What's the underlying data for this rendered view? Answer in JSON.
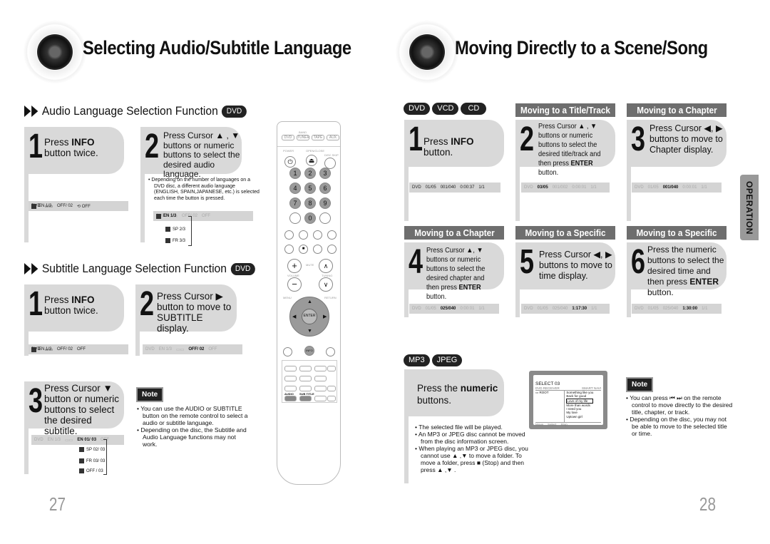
{
  "left_page": {
    "title": "Selecting Audio/Subtitle Language",
    "page_number": "27",
    "audio_section": {
      "heading": "Audio Language Selection Function",
      "badge": "DVD",
      "step1": {
        "num": "1",
        "text_a": "Press ",
        "bold": "INFO",
        "text_b": " button twice."
      },
      "step2": {
        "num": "2",
        "text": "Press Cursor ▲ , ▼ buttons or numeric buttons to select the desired audio language."
      },
      "step2_note": "Depending on the number of languages on a DVD disc, a different audio language (ENGLISH, SPAIN,JAPANESE, etc.) is selected each time the button is pressed.",
      "osd1": [
        "DVD",
        "EN 1/3",
        "OFF/ 02",
        "OFF"
      ],
      "osd2": [
        "DVD",
        "EN 1/3",
        "OFF/ 02",
        "OFF"
      ],
      "options": [
        "SP 2/3",
        "FR 3/3"
      ]
    },
    "subtitle_section": {
      "heading": "Subtitle Language Selection Function",
      "badge": "DVD",
      "step1": {
        "num": "1",
        "text_a": "Press ",
        "bold": "INFO",
        "text_b": " button twice."
      },
      "step2": {
        "num": "2",
        "text": "Press Cursor ▶ button to move to SUBTITLE display."
      },
      "step3": {
        "num": "3",
        "text": "Press Cursor ▼ button or numeric buttons to select the desired subtitle."
      },
      "osd1": [
        "DVD",
        "EN 1/3",
        "OFF/ 02",
        "OFF"
      ],
      "osd2": [
        "DVD",
        "EN 1/3",
        "OFF/ 02",
        "OFF"
      ],
      "osd3": [
        "DVD",
        "EN 1/3",
        "EN 01/ 03",
        "OFF"
      ],
      "options": [
        "SP 02/ 03",
        "FR 03/ 03",
        "OFF / 03"
      ]
    },
    "note": {
      "label": "Note",
      "items": [
        "You can use the AUDIO or SUBTITLE button on the remote control to select a audio or subtitle language.",
        "Depending on the disc, the Subtitle and Audio Language functions may not work."
      ]
    },
    "remote": {
      "sources": [
        "DVD",
        "TUNER",
        "TAPE",
        "AUX"
      ],
      "numbers": [
        "1",
        "2",
        "3",
        "4",
        "5",
        "6",
        "7",
        "8",
        "9",
        "0"
      ],
      "enter": "ENTER",
      "info": "INFO",
      "labels": [
        "POWER",
        "OPEN/CLOSE",
        "DISC SKIP",
        "VOLUME",
        "MUTE",
        "TUNING",
        "MENU",
        "RETURN",
        "AUDIO",
        "SUB TITLE"
      ]
    }
  },
  "right_page": {
    "title": "Moving Directly to a Scene/Song",
    "page_number": "28",
    "side_tab": "OPERATION",
    "disc_badges": [
      "DVD",
      "VCD",
      "CD"
    ],
    "banners": {
      "title_track": "Moving to a Title/Track",
      "chapter_a": "Moving to a Chapter",
      "chapter_b": "Moving to a Chapter",
      "time_a": "Moving to a Specific Time",
      "time_b": "Moving to a Specific Time"
    },
    "step1": {
      "num": "1",
      "text_a": "Press ",
      "bold": "INFO",
      "text_b": " button."
    },
    "step2": {
      "num": "2",
      "text_a": "Press Cursor ▲ , ▼ buttons or numeric buttons to select the desired title/track and then press ",
      "bold": "ENTER",
      "text_b": " button."
    },
    "step3": {
      "num": "3",
      "text": "Press Cursor ◀, ▶ buttons to move to Chapter display."
    },
    "step4": {
      "num": "4",
      "text_a": "Press Cursor ▲, ▼ buttons or numeric buttons to select the desired chapter and then press ",
      "bold": "ENTER",
      "text_b": " button."
    },
    "step5": {
      "num": "5",
      "text": "Press Cursor ◀, ▶ buttons to move to time display."
    },
    "step6": {
      "num": "6",
      "text_a": "Press the numeric buttons to select the desired time and then press ",
      "bold": "ENTER",
      "text_b": " button."
    },
    "osd": {
      "s1": [
        "DVD",
        "01/05",
        "001/040",
        "0:00:37",
        "1/1"
      ],
      "s2": [
        "DVD",
        "03/05",
        "001/002",
        "0:00:01",
        "1/1"
      ],
      "s3": [
        "DVD",
        "01/05",
        "001/040",
        "0:00:01",
        "1/1"
      ],
      "s4": [
        "DVD",
        "01/05",
        "025/040",
        "0:00:01",
        "1/1"
      ],
      "s5": [
        "DVD",
        "01/05",
        "025/040",
        "1:17:30",
        "1/1"
      ],
      "s6": [
        "DVD",
        "01/05",
        "025/040",
        "1:30:00",
        "1/1"
      ]
    },
    "mp3_badges": [
      "MP3",
      "JPEG"
    ],
    "mp3_step": {
      "text_a": "Press the ",
      "bold": "numeric",
      "text_b": " buttons."
    },
    "mp3_notes": [
      "The selected file will be played.",
      "An MP3 or JPEG disc cannot be moved from the disc information screen.",
      "When playing an MP3 or JPEG disc, you cannot use ▲ ,▼  to move a folder. To move a folder, press ■ (Stop) and then press ▲ ,▼ ."
    ],
    "tv_screen": {
      "title": "SELECT 03",
      "header_left": "DVD RECEIVER",
      "header_right": "SMART NAVI",
      "folder": "ROOT",
      "files": [
        "Something like you",
        "Back for good",
        "Love of my life",
        "More than words",
        "I need you",
        "My love",
        "Uptown girl"
      ],
      "selected_index": 2,
      "footer": [
        "Move",
        "Select",
        "Stop"
      ]
    },
    "note": {
      "label": "Note",
      "items": [
        "You can press ⏮ ⏭ on the remote control to move directly to the desired title, chapter, or track.",
        "Depending on the disc, you may not be able to move to the selected title or time."
      ]
    }
  }
}
